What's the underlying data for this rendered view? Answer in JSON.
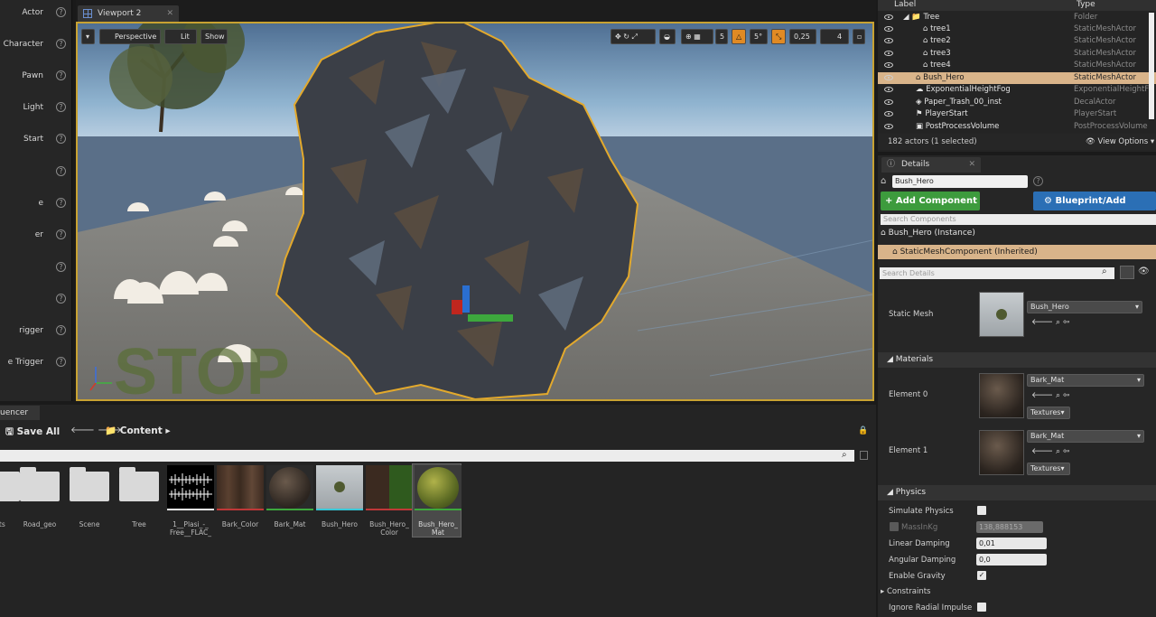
{
  "palette": {
    "items": [
      "Actor",
      "Character",
      "Pawn",
      "Light",
      "Start",
      "",
      "e",
      "er",
      "",
      "",
      "rigger",
      "e Trigger"
    ],
    "help": "?"
  },
  "viewport": {
    "tab": "Viewport 2",
    "perspective": "Perspective",
    "lit": "Lit",
    "show": "Show",
    "grid_value": "5",
    "angle_value": "5°",
    "scale_value": "0,25",
    "speed_value": "4",
    "stop_text": "STOP"
  },
  "outliner": {
    "col_label": "Label",
    "col_type": "Type",
    "rows": [
      {
        "label": "Tree",
        "type": "Folder"
      },
      {
        "label": "tree1",
        "type": "StaticMeshActor"
      },
      {
        "label": "tree2",
        "type": "StaticMeshActor"
      },
      {
        "label": "tree3",
        "type": "StaticMeshActor"
      },
      {
        "label": "tree4",
        "type": "StaticMeshActor"
      },
      {
        "label": "Bush_Hero",
        "type": "StaticMeshActor"
      },
      {
        "label": "ExponentialHeightFog",
        "type": "ExponentialHeightF"
      },
      {
        "label": "Paper_Trash_00_inst",
        "type": "DecalActor"
      },
      {
        "label": "PlayerStart",
        "type": "PlayerStart"
      },
      {
        "label": "PostProcessVolume",
        "type": "PostProcessVolume"
      }
    ],
    "status": "182 actors (1 selected)",
    "view_options": "View Options"
  },
  "details": {
    "tab": "Details",
    "name": "Bush_Hero",
    "add_component": "+ Add Component",
    "blueprint": "Blueprint/Add Script",
    "search_components": "Search Components",
    "instance": "Bush_Hero (Instance)",
    "component": "StaticMeshComponent (Inherited)",
    "search_details": "Search Details",
    "static_mesh_label": "Static Mesh",
    "static_mesh_value": "Bush_Hero",
    "materials_section": "Materials",
    "element0": "Element 0",
    "element0_value": "Bark_Mat",
    "element1": "Element 1",
    "element1_value": "Bark_Mat",
    "textures": "Textures",
    "physics_section": "Physics",
    "simulate_physics": "Simulate Physics",
    "mass_label": "MassInKg",
    "mass_value": "138,888153",
    "linear_damping": "Linear Damping",
    "linear_damping_value": "0,01",
    "angular_damping": "Angular Damping",
    "angular_damping_value": "0,0",
    "enable_gravity": "Enable Gravity",
    "constraints": "Constraints",
    "ignore_radial": "Ignore Radial Impulse"
  },
  "content": {
    "sequencer_tab": "uencer",
    "save_all": "Save All",
    "path": "Content",
    "assets": [
      {
        "name": "ets",
        "kind": "folder"
      },
      {
        "name": "Road_geo",
        "kind": "folder"
      },
      {
        "name": "Scene",
        "kind": "folder"
      },
      {
        "name": "Tree",
        "kind": "folder"
      },
      {
        "name": "1__Plasi_-_ Free__FLAC_",
        "kind": "audio"
      },
      {
        "name": "Bark_Color",
        "kind": "texture"
      },
      {
        "name": "Bark_Mat",
        "kind": "material"
      },
      {
        "name": "Bush_Hero",
        "kind": "mesh"
      },
      {
        "name": "Bush_Hero_ Color",
        "kind": "texture2"
      },
      {
        "name": "Bush_Hero_ Mat",
        "kind": "material2"
      }
    ]
  },
  "colors": {
    "selection": "#d9b48a",
    "add_component": "#3d9b3d",
    "blueprint": "#2b6fb5",
    "viewport_border": "#c8a232"
  }
}
